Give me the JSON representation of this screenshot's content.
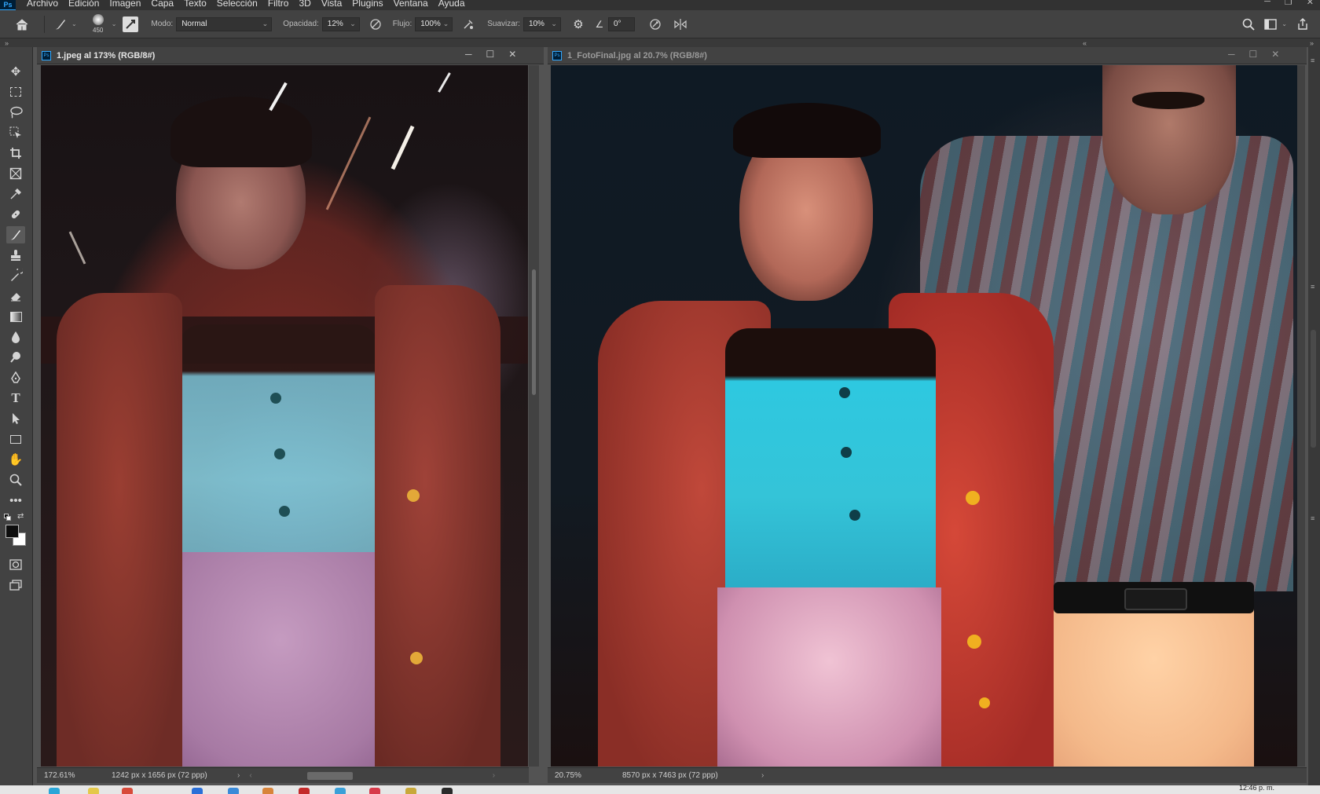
{
  "app": {
    "logo": "Ps"
  },
  "menu": [
    "Archivo",
    "Edición",
    "Imagen",
    "Capa",
    "Texto",
    "Selección",
    "Filtro",
    "3D",
    "Vista",
    "Plugins",
    "Ventana",
    "Ayuda"
  ],
  "options": {
    "brush_size": "450",
    "mode_label": "Modo:",
    "mode_value": "Normal",
    "opacity_label": "Opacidad:",
    "opacity_value": "12%",
    "flow_label": "Flujo:",
    "flow_value": "100%",
    "smoothing_label": "Suavizar:",
    "smoothing_value": "10%",
    "angle_value": "0°"
  },
  "doc1": {
    "title": "1.jpeg al 173% (RGB/8#)",
    "zoom": "172.61%",
    "dimensions": "1242 px x 1656 px (72 ppp)"
  },
  "doc2": {
    "title": "1_FotoFinal.jpg al 20.7% (RGB/8#)",
    "zoom": "20.75%",
    "dimensions": "8570 px x 7463 px (72 ppp)"
  },
  "taskbar": {
    "time": "12:46 p. m."
  },
  "icons": {
    "home": "home-icon",
    "brush": "brush-icon",
    "search": "search-icon",
    "workspace": "workspace-icon",
    "share": "share-icon"
  }
}
